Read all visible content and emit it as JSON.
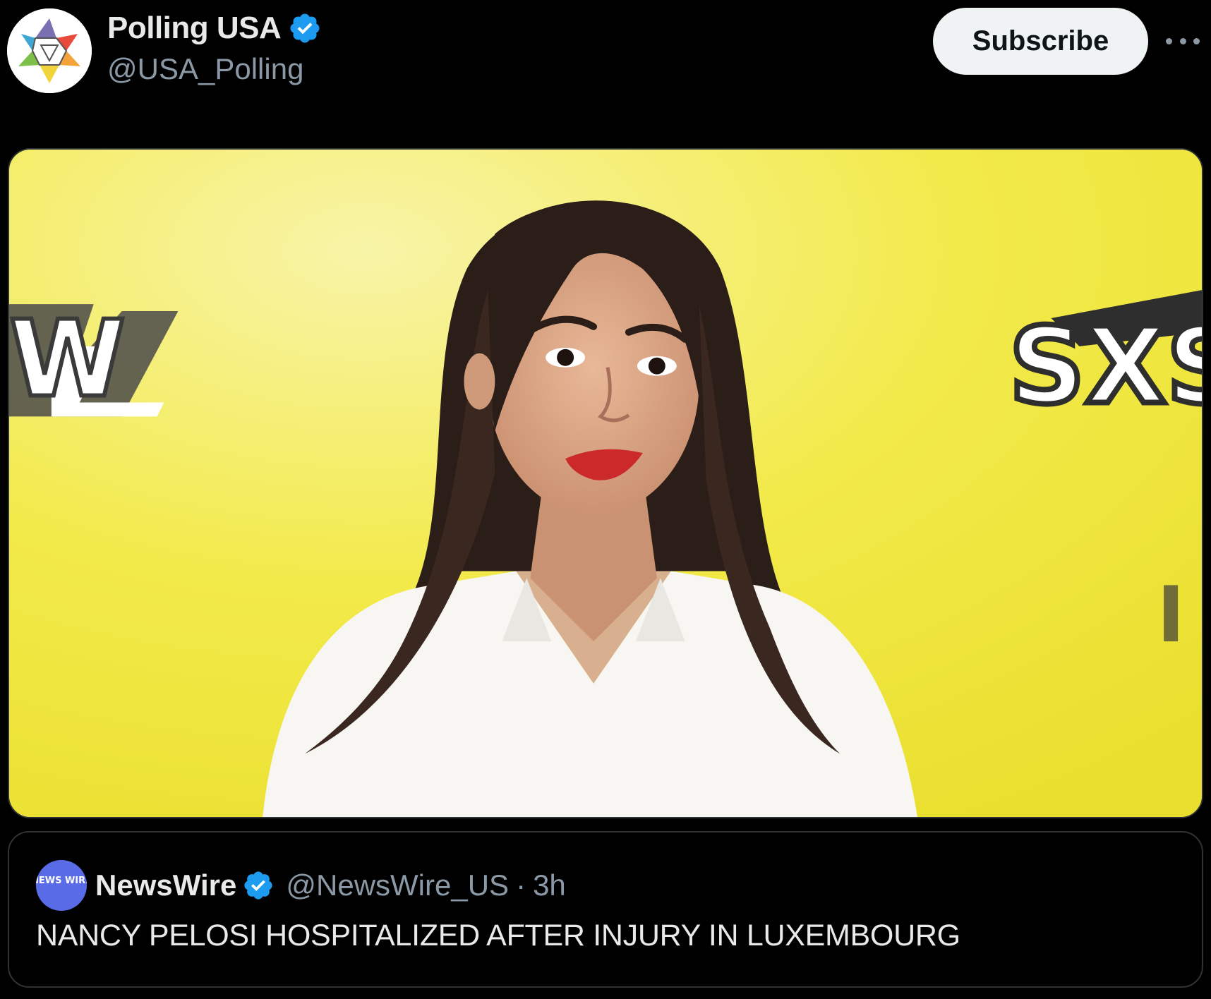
{
  "post": {
    "author": {
      "display_name": "Polling USA",
      "handle": "@USA_Polling",
      "verified": true,
      "avatar_icon": "star-logo-icon"
    },
    "subscribe_label": "Subscribe",
    "more_icon": "more-horizontal-icon",
    "media": {
      "kind": "photo",
      "backdrop_text_left": "W",
      "backdrop_text_right": "SXS"
    }
  },
  "quote": {
    "author": {
      "display_name": "NewsWire",
      "handle": "@NewsWire_US",
      "verified": true,
      "avatar_text": "NEWS WIRE"
    },
    "separator": "·",
    "time": "3h",
    "text": "NANCY PELOSI HOSPITALIZED AFTER INJURY IN LUXEMBOURG"
  },
  "colors": {
    "background": "#000000",
    "primary_text": "#e7e9ea",
    "secondary_text": "#8b98a5",
    "verified_blue": "#1d9bf0",
    "border": "#2f3336",
    "photo_backdrop": "#f2ea4a"
  }
}
